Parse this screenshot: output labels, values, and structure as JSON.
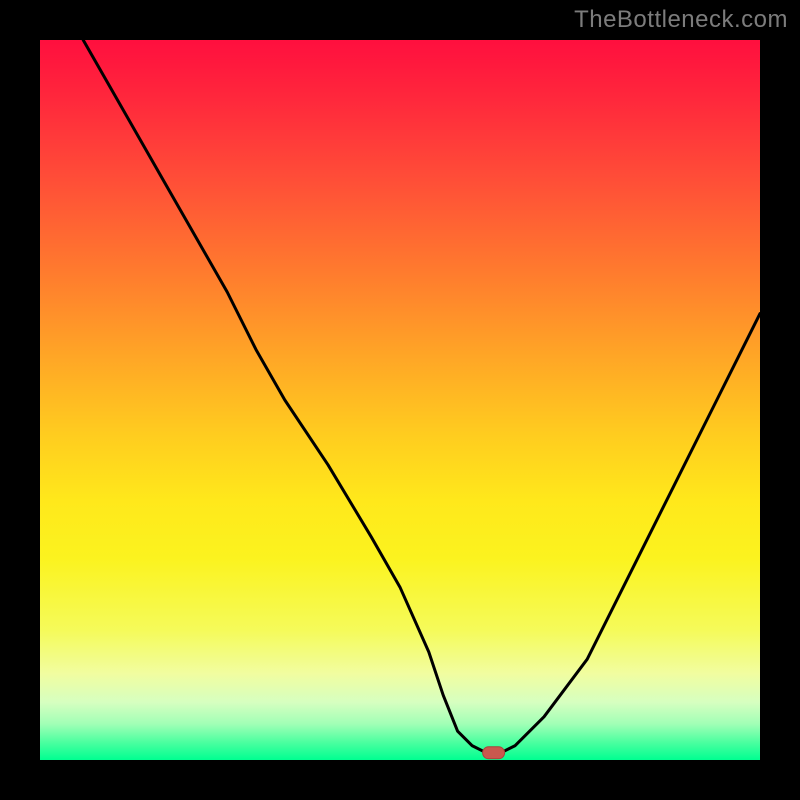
{
  "watermark": "TheBottleneck.com",
  "chart_data": {
    "type": "line",
    "title": "",
    "xlabel": "",
    "ylabel": "",
    "xlim": [
      0,
      100
    ],
    "ylim": [
      0,
      100
    ],
    "series": [
      {
        "name": "curve",
        "x": [
          6,
          10,
          18,
          26,
          30,
          34,
          40,
          46,
          50,
          54,
          56,
          58,
          60,
          62,
          64,
          66,
          70,
          76,
          82,
          88,
          94,
          100
        ],
        "y": [
          100,
          93,
          79,
          65,
          57,
          50,
          41,
          31,
          24,
          15,
          9,
          4,
          2,
          1,
          1,
          2,
          6,
          14,
          26,
          38,
          50,
          62
        ]
      }
    ],
    "flat_segment": {
      "x_start": 58,
      "x_end": 66,
      "y": 1
    },
    "marker": {
      "x": 63,
      "y": 1,
      "shape": "pill"
    },
    "background": "vertical-gradient red→orange→yellow→green",
    "frame": "black 40px border"
  }
}
